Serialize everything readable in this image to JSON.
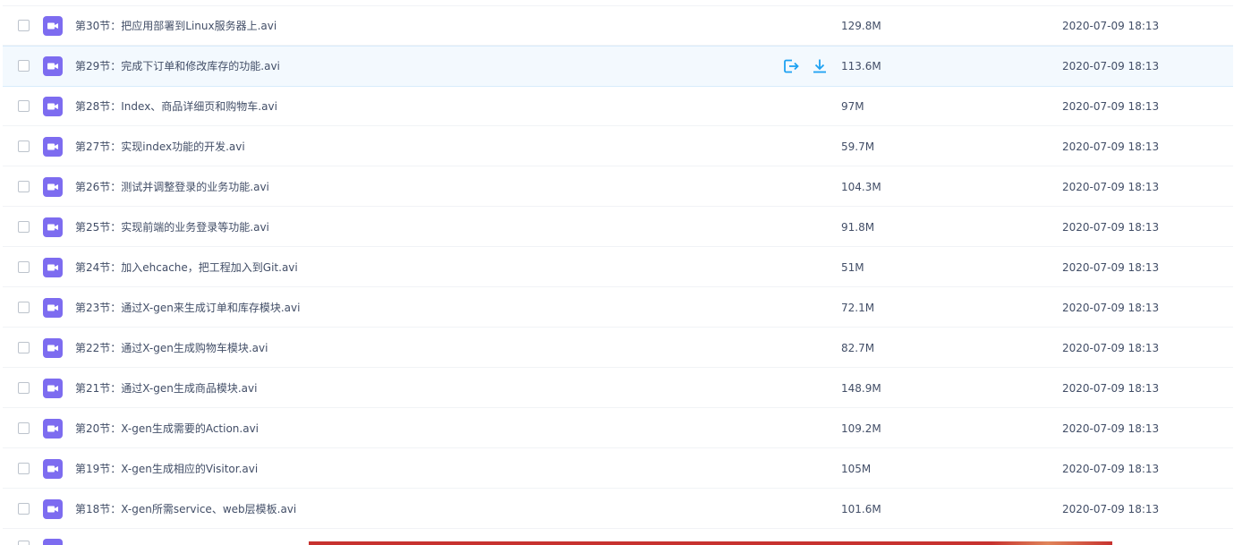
{
  "colors": {
    "icon_purple": "#7d6cf0",
    "action_blue": "#1da1f2",
    "text": "#424e67",
    "hover_row": "#f3f9fe"
  },
  "row_actions": {
    "share_icon": "share-icon",
    "download_icon": "download-icon"
  },
  "files": [
    {
      "name": "第30节：把应用部署到Linux服务器上.avi",
      "size": "129.8M",
      "date": "2020-07-09 18:13"
    },
    {
      "name": "第29节：完成下订单和修改库存的功能.avi",
      "size": "113.6M",
      "date": "2020-07-09 18:13"
    },
    {
      "name": "第28节：Index、商品详细页和购物车.avi",
      "size": "97M",
      "date": "2020-07-09 18:13"
    },
    {
      "name": "第27节：实现index功能的开发.avi",
      "size": "59.7M",
      "date": "2020-07-09 18:13"
    },
    {
      "name": "第26节：测试并调整登录的业务功能.avi",
      "size": "104.3M",
      "date": "2020-07-09 18:13"
    },
    {
      "name": "第25节：实现前端的业务登录等功能.avi",
      "size": "91.8M",
      "date": "2020-07-09 18:13"
    },
    {
      "name": "第24节：加入ehcache，把工程加入到Git.avi",
      "size": "51M",
      "date": "2020-07-09 18:13"
    },
    {
      "name": "第23节：通过X-gen来生成订单和库存模块.avi",
      "size": "72.1M",
      "date": "2020-07-09 18:13"
    },
    {
      "name": "第22节：通过X-gen生成购物车模块.avi",
      "size": "82.7M",
      "date": "2020-07-09 18:13"
    },
    {
      "name": "第21节：通过X-gen生成商品模块.avi",
      "size": "148.9M",
      "date": "2020-07-09 18:13"
    },
    {
      "name": "第20节：X-gen生成需要的Action.avi",
      "size": "109.2M",
      "date": "2020-07-09 18:13"
    },
    {
      "name": "第19节：X-gen生成相应的Visitor.avi",
      "size": "105M",
      "date": "2020-07-09 18:13"
    },
    {
      "name": "第18节：X-gen所需service、web层模板.avi",
      "size": "101.6M",
      "date": "2020-07-09 18:13"
    }
  ]
}
